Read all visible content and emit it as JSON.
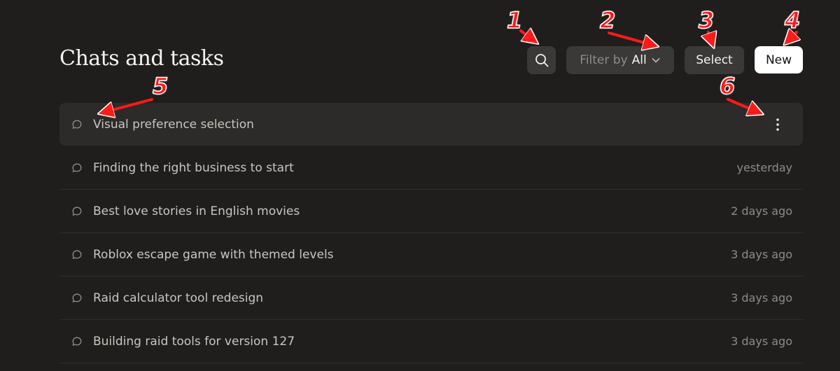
{
  "header": {
    "title": "Chats and tasks",
    "filter_prefix": "Filter by",
    "filter_value": "All",
    "select_label": "Select",
    "new_label": "New"
  },
  "chats": [
    {
      "title": "Visual preference selection",
      "time": ""
    },
    {
      "title": "Finding the right business to start",
      "time": "yesterday"
    },
    {
      "title": "Best love stories in English movies",
      "time": "2 days ago"
    },
    {
      "title": "Roblox escape game with themed levels",
      "time": "3 days ago"
    },
    {
      "title": "Raid calculator tool redesign",
      "time": "3 days ago"
    },
    {
      "title": "Building raid tools for version 127",
      "time": "3 days ago"
    }
  ],
  "annotations": [
    "1",
    "2",
    "3",
    "4",
    "5",
    "6"
  ],
  "icons": {
    "search": "search-icon",
    "filter": "chevron-down-icon",
    "chat": "chat-bubble-icon",
    "more": "more-vertical-icon"
  },
  "colors": {
    "background": "#1f1e1d",
    "button": "#3a3937",
    "primary_button": "#ffffff",
    "annotation": "#ff1a1a"
  }
}
